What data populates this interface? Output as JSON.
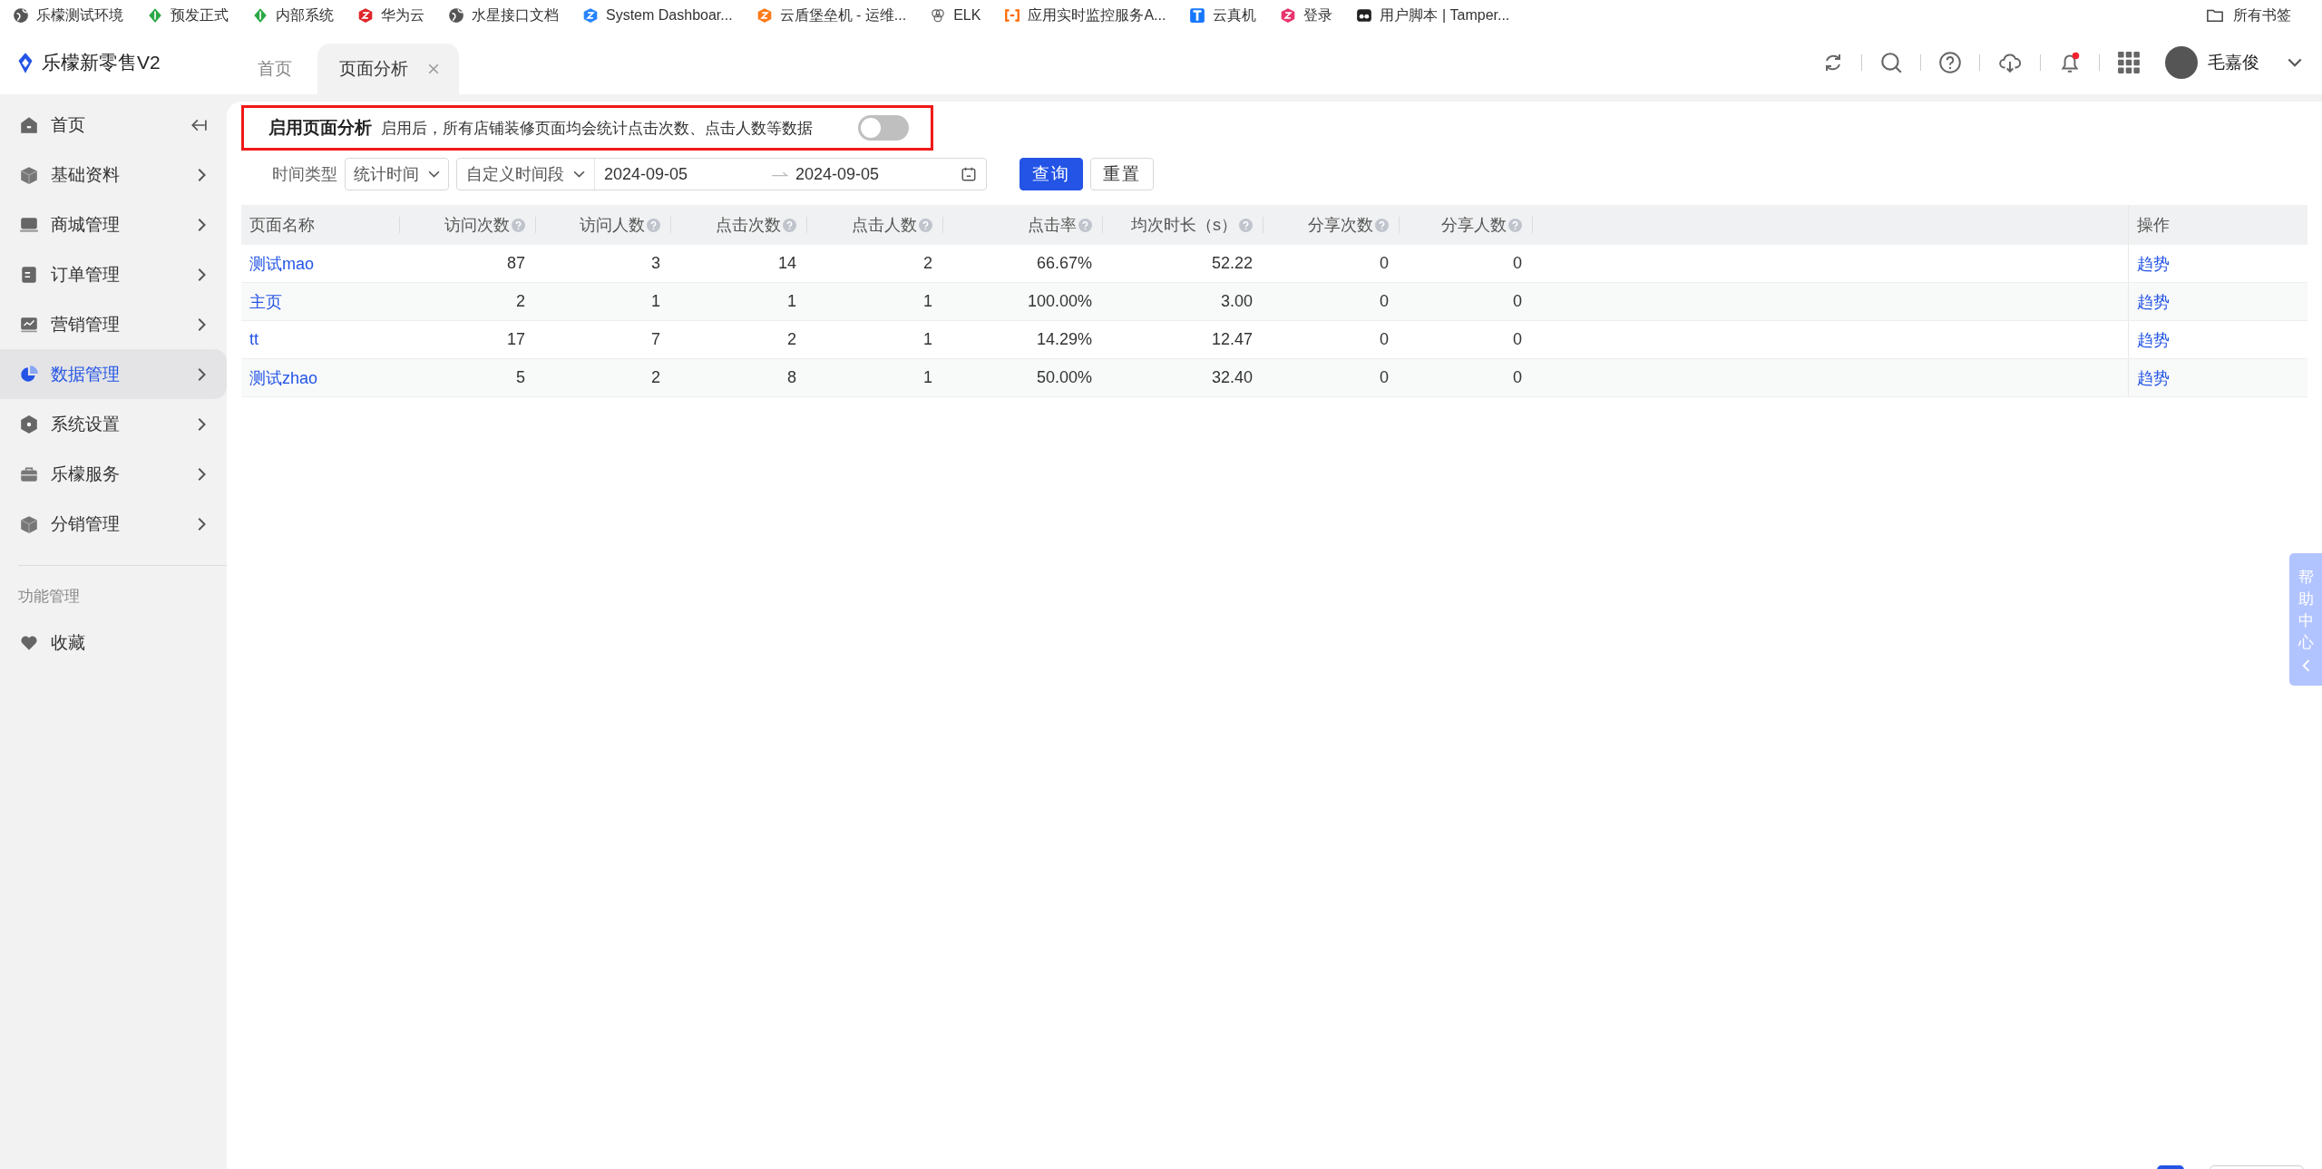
{
  "bookmarks": [
    {
      "label": "乐檬测试环境"
    },
    {
      "label": "预发正式"
    },
    {
      "label": "内部系统"
    },
    {
      "label": "华为云"
    },
    {
      "label": "水星接口文档"
    },
    {
      "label": "System Dashboar..."
    },
    {
      "label": "云盾堡垒机 - 运维..."
    },
    {
      "label": "ELK"
    },
    {
      "label": "应用实时监控服务A..."
    },
    {
      "label": "云真机"
    },
    {
      "label": "登录"
    },
    {
      "label": "用户脚本 | Tamper..."
    }
  ],
  "all_bookmarks": "所有书签",
  "app": {
    "title": "乐檬新零售V2"
  },
  "tabs": [
    {
      "label": "首页",
      "selected": false,
      "closable": false
    },
    {
      "label": "页面分析",
      "selected": true,
      "closable": true
    }
  ],
  "user": {
    "name": "毛嘉俊",
    "has_notification": true
  },
  "sidebar": {
    "items": [
      {
        "label": "首页",
        "selected": false,
        "expandable": false
      },
      {
        "label": "基础资料",
        "selected": false,
        "expandable": true
      },
      {
        "label": "商城管理",
        "selected": false,
        "expandable": true
      },
      {
        "label": "订单管理",
        "selected": false,
        "expandable": true
      },
      {
        "label": "营销管理",
        "selected": false,
        "expandable": true
      },
      {
        "label": "数据管理",
        "selected": true,
        "expandable": true
      },
      {
        "label": "系统设置",
        "selected": false,
        "expandable": true
      },
      {
        "label": "乐檬服务",
        "selected": false,
        "expandable": true
      },
      {
        "label": "分销管理",
        "selected": false,
        "expandable": true
      }
    ],
    "section_title": "功能管理",
    "favorites": "收藏"
  },
  "enable_bar": {
    "title": "启用页面分析",
    "description": "启用后，所有店铺装修页面均会统计点击次数、点击人数等数据",
    "on": false,
    "highlighted": true
  },
  "filters": {
    "time_type_label": "时间类型",
    "time_type": "统计时间",
    "range_type": "自定义时间段",
    "start_date": "2024-09-05",
    "end_date": "2024-09-05",
    "search_button": "查询",
    "reset_button": "重置"
  },
  "table": {
    "columns": [
      {
        "label": "页面名称",
        "help": false
      },
      {
        "label": "访问次数",
        "help": true
      },
      {
        "label": "访问人数",
        "help": true
      },
      {
        "label": "点击次数",
        "help": true
      },
      {
        "label": "点击人数",
        "help": true
      },
      {
        "label": "点击率",
        "help": true
      },
      {
        "label": "均次时长（s）",
        "help": true
      },
      {
        "label": "分享次数",
        "help": true
      },
      {
        "label": "分享人数",
        "help": true
      }
    ],
    "action_column": "操作",
    "rows": [
      {
        "cells": [
          "测试mao",
          "87",
          "3",
          "14",
          "2",
          "66.67%",
          "52.22",
          "0",
          "0"
        ],
        "action": "趋势"
      },
      {
        "cells": [
          "主页",
          "2",
          "1",
          "1",
          "1",
          "100.00%",
          "3.00",
          "0",
          "0"
        ],
        "action": "趋势"
      },
      {
        "cells": [
          "tt",
          "17",
          "7",
          "2",
          "1",
          "14.29%",
          "12.47",
          "0",
          "0"
        ],
        "action": "趋势"
      },
      {
        "cells": [
          "测试zhao",
          "5",
          "2",
          "8",
          "1",
          "50.00%",
          "32.40",
          "0",
          "0"
        ],
        "action": "趋势"
      }
    ]
  },
  "help_center": "帮助中心"
}
